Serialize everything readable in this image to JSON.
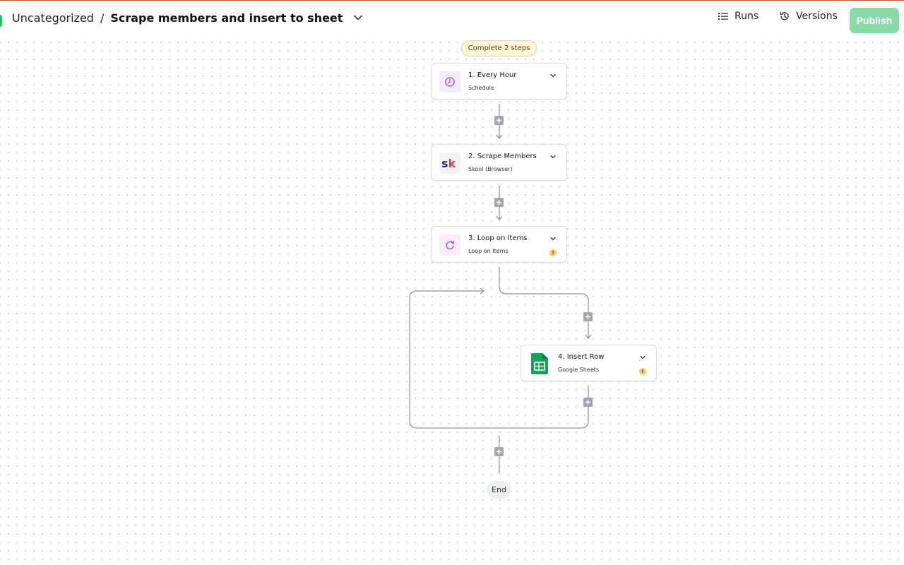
{
  "header": {
    "folder": "Uncategorized",
    "separator": "/",
    "flow_name": "Scrape members and insert to sheet",
    "runs_label": "Runs",
    "versions_label": "Versions",
    "publish_label": "Publish"
  },
  "canvas": {
    "badge": "Complete 2 steps",
    "end_label": "End",
    "steps": [
      {
        "title": "1. Every Hour",
        "subtitle": "Schedule",
        "icon": "schedule-clock-icon"
      },
      {
        "title": "2. Scrape Members",
        "subtitle": "Skool (Browser)",
        "icon": "skool-logo-icon",
        "logo_text": "sk"
      },
      {
        "title": "3. Loop on Items",
        "subtitle": "Loop on Items",
        "icon": "loop-icon",
        "warning": "!"
      },
      {
        "title": "4. Insert Row",
        "subtitle": "Google Sheets",
        "icon": "google-sheets-icon",
        "warning": "!"
      }
    ]
  },
  "colors": {
    "publish_bg": "#86dba6",
    "badge_bg": "#fef6d8",
    "accent_purple": "#a855f7",
    "sheets_green": "#1aa15f",
    "skool_red": "#e03a3e",
    "skool_blue": "#1d2b6f",
    "warning": "#fbc86b"
  }
}
